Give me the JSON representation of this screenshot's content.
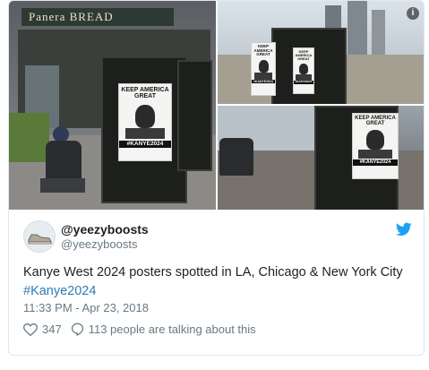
{
  "media": {
    "store_sign": "Panera BREAD",
    "poster_headline": "KEEP AMERICA GREAT",
    "poster_tag": "#KANYE2024",
    "info_icon": "info-icon"
  },
  "tweet": {
    "display_name": "@yeezyboosts",
    "handle": "@yeezyboosts",
    "text_main": "Kanye West 2024 posters spotted in LA, Chicago & New York City",
    "hashtag": "#Kanye2024",
    "timestamp": "11:33 PM - Apr 23, 2018",
    "likes": "347",
    "talking": "113 people are talking about this",
    "brand_icon": "twitter-bird-icon",
    "brand_color": "#1da1f2"
  }
}
